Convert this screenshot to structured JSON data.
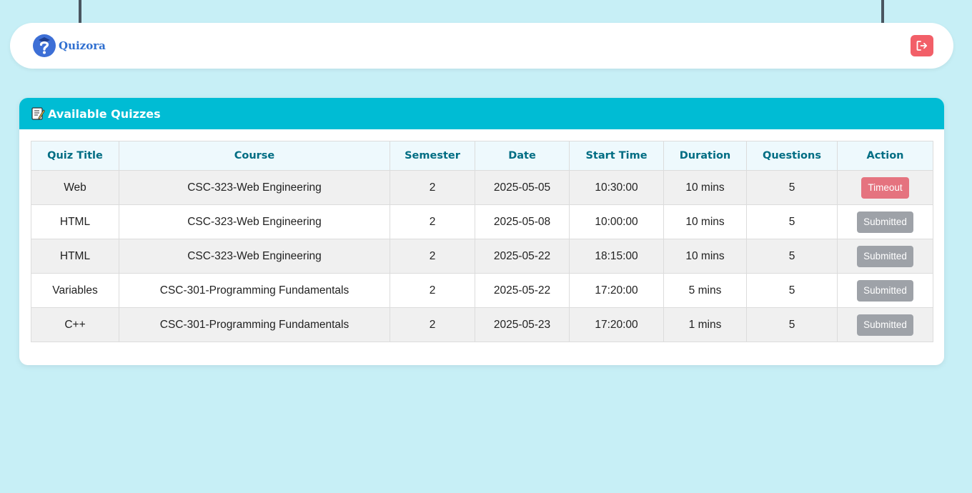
{
  "brand": {
    "name": "Quizora"
  },
  "navbar": {
    "logout_icon": "logout-icon"
  },
  "card": {
    "title_icon": "memo-icon",
    "title": "Available Quizzes"
  },
  "table": {
    "headers": [
      "Quiz Title",
      "Course",
      "Semester",
      "Date",
      "Start Time",
      "Duration",
      "Questions",
      "Action"
    ],
    "rows": [
      {
        "title": "Web",
        "course": "CSC-323-Web Engineering",
        "semester": "2",
        "date": "2025-05-05",
        "start_time": "10:30:00",
        "duration": "10 mins",
        "questions": "5",
        "action": "Timeout",
        "action_type": "timeout"
      },
      {
        "title": "HTML",
        "course": "CSC-323-Web Engineering",
        "semester": "2",
        "date": "2025-05-08",
        "start_time": "10:00:00",
        "duration": "10 mins",
        "questions": "5",
        "action": "Submitted",
        "action_type": "submitted"
      },
      {
        "title": "HTML",
        "course": "CSC-323-Web Engineering",
        "semester": "2",
        "date": "2025-05-22",
        "start_time": "18:15:00",
        "duration": "10 mins",
        "questions": "5",
        "action": "Submitted",
        "action_type": "submitted"
      },
      {
        "title": "Variables",
        "course": "CSC-301-Programming Fundamentals",
        "semester": "2",
        "date": "2025-05-22",
        "start_time": "17:20:00",
        "duration": "5 mins",
        "questions": "5",
        "action": "Submitted",
        "action_type": "submitted"
      },
      {
        "title": "C++",
        "course": "CSC-301-Programming Fundamentals",
        "semester": "2",
        "date": "2025-05-23",
        "start_time": "17:20:00",
        "duration": "1 mins",
        "questions": "5",
        "action": "Submitted",
        "action_type": "submitted"
      }
    ]
  },
  "colors": {
    "page_background": "#c7eff6",
    "header_accent": "#00bcd4",
    "table_header_text": "#006d83",
    "timeout": "#e5737f",
    "submitted": "#9ea2a8",
    "logout": "#f25f68",
    "brand": "#2f6fd0"
  }
}
